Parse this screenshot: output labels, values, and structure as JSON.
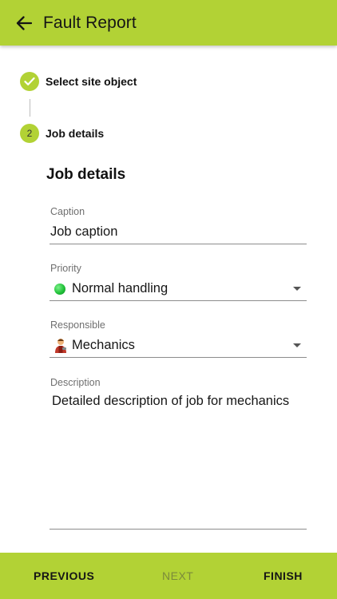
{
  "header": {
    "title": "Fault Report",
    "back_icon": "arrow-left-icon"
  },
  "stepper": {
    "steps": [
      {
        "label": "Select site object",
        "state": "completed",
        "icon": "check-icon"
      },
      {
        "label": "Job details",
        "state": "active",
        "number": "2"
      }
    ]
  },
  "form": {
    "section_title": "Job details",
    "caption": {
      "label": "Caption",
      "value": "Job caption"
    },
    "priority": {
      "label": "Priority",
      "value": "Normal handling",
      "icon": "green-status-dot-icon"
    },
    "responsible": {
      "label": "Responsible",
      "value": "Mechanics",
      "icon": "mechanic-person-icon"
    },
    "description": {
      "label": "Description",
      "value": "Detailed description of job for mechanics"
    }
  },
  "bottom_bar": {
    "previous_label": "PREVIOUS",
    "next_label": "NEXT",
    "finish_label": "FINISH"
  },
  "colors": {
    "accent": "#b2d235",
    "text": "#161616",
    "label": "#6f6f6f",
    "disabled": "#7b8b3a"
  }
}
